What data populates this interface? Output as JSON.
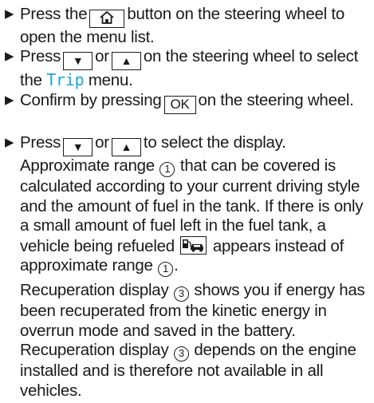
{
  "colors": {
    "text": "#1a1a1a",
    "menu_highlight": "#1aa6d6"
  },
  "bullet_icon": "right-triangle-bullet",
  "steps": [
    {
      "before": "Press the",
      "key_icon": "home-icon",
      "after": "button on the steering wheel to open the menu list."
    },
    {
      "before": "Press",
      "key_down": "▼",
      "or": "or",
      "key_up": "▲",
      "middle": "on the steering wheel to select the",
      "menu_name": "Trip",
      "after": "menu."
    },
    {
      "before": "Confirm by pressing",
      "key_ok": "OK",
      "after": "on the steering wheel."
    },
    {
      "before": "Press",
      "key_down": "▼",
      "or": "or",
      "key_up": "▲",
      "after": "to select the display.",
      "range_para": {
        "t1": "Approximate range",
        "ref1": "1",
        "t2": "that can be covered is calculated according to your current driving style and the amount of fuel in the tank. If there is only a small amount of fuel left in the fuel tank, a vehicle being refueled",
        "refuel_icon": "vehicle-refueling-icon",
        "t3": "appears instead of approximate range",
        "ref2": "1",
        "t4": "."
      },
      "recup_para": {
        "t1": "Recuperation display",
        "ref1": "3",
        "t2": "shows you if energy has been recuperated from the kinetic energy in overrun mode and saved in the battery. Recuperation display",
        "ref2": "3",
        "t3": "depends on the engine installed and is therefore not available in all vehicles."
      }
    }
  ]
}
